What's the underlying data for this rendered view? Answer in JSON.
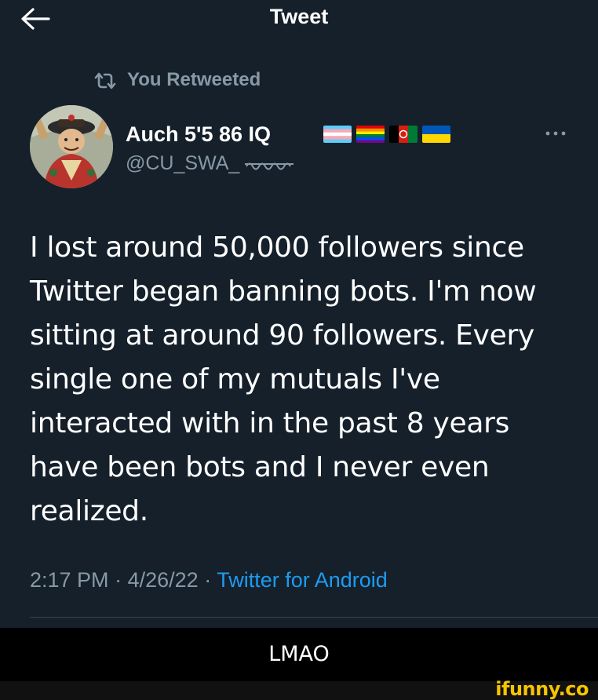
{
  "header": {
    "title": "Tweet",
    "back_icon": "back-arrow-icon"
  },
  "retweet": {
    "label": "You Retweeted",
    "icon": "retweet-icon"
  },
  "author": {
    "display_name": "Auch 5'5 86 IQ",
    "handle": "@CU_SWA_",
    "flags": [
      "transgender-flag",
      "rainbow-flag",
      "afghanistan-flag",
      "ukraine-flag"
    ]
  },
  "tweet": {
    "text": "I lost around 50,000 followers since Twitter began banning bots. I'm now sitting at around 90 followers. Every single one of my mutuals I've interacted with in the past 8 years have been bots and I never even realized.",
    "time": "2:17 PM",
    "date": "4/26/22",
    "separator": "·",
    "source": "Twitter for Android"
  },
  "caption": "LMAO",
  "watermark": "ifunny.co",
  "colors": {
    "background": "#15202b",
    "secondary_text": "#8899a6",
    "link": "#1d9bf0",
    "watermark": "#f5c400"
  }
}
